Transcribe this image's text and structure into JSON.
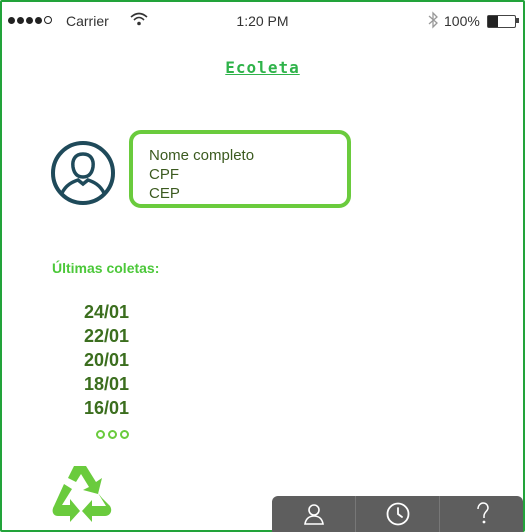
{
  "status_bar": {
    "carrier": "Carrier",
    "time": "1:20 PM",
    "battery": "100%"
  },
  "app": {
    "title": "Ecoleta"
  },
  "profile": {
    "fields": [
      "Nome completo",
      "CPF",
      "CEP"
    ]
  },
  "collections": {
    "label": "Últimas coletas:",
    "dates": [
      "24/01",
      "22/01",
      "20/01",
      "18/01",
      "16/01"
    ]
  },
  "tabbar": {
    "tabs": [
      {
        "icon": "user-icon"
      },
      {
        "icon": "clock-icon"
      },
      {
        "icon": "help-icon"
      }
    ]
  },
  "colors": {
    "accent": "#6acb3d",
    "frame": "#22a33a",
    "avatar": "#1f4a5a",
    "tabbar": "#5e5e5e"
  }
}
